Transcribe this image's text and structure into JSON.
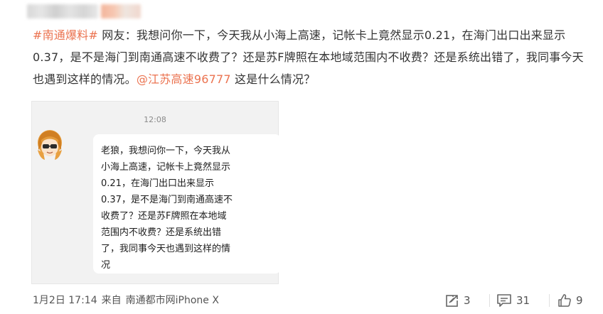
{
  "post": {
    "topic": "#南通爆料#",
    "body_1": " 网友：我想问你一下，今天我从小海上高速，记帐卡上竟然显示0.21，在海门出口出来显示0.37，是不是海门到南通高速不收费了？还是苏F牌照在本地域范围内不收费？还是系统出错了，我同事今天也遇到这样的情况。",
    "mention": "@江苏高速96777",
    "body_2": " 这是什么情况？"
  },
  "screenshot": {
    "time": "12:08",
    "message": "老狼，我想问你一下，今天我从\n小海上高速，记帐卡上竟然显示\n0.21，在海门出口出来显示\n0.37，是不是海门到南通高速不\n收费了？还是苏F牌照在本地域\n范围内不收费？还是系统出错\n了，我同事今天也遇到这样的情\n况"
  },
  "footer": {
    "date": "1月2日 17:14",
    "source_prefix": "来自",
    "source": "南通都市网iPhone X"
  },
  "actions": {
    "repost_count": "3",
    "comment_count": "31",
    "like_count": "9"
  },
  "icons": [
    "repost-icon",
    "comment-icon",
    "like-icon"
  ],
  "colors": {
    "link": "#eb7350",
    "text": "#333333",
    "meta": "#555555"
  }
}
